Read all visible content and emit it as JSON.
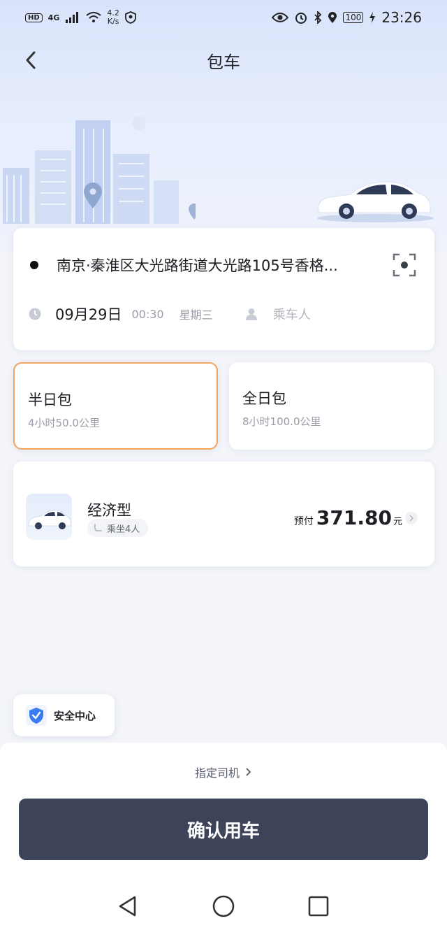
{
  "status_bar": {
    "hd_badge": "HD",
    "network": "4G",
    "speed_value": "4.2",
    "speed_unit": "K/s",
    "battery": "100",
    "time": "23:26"
  },
  "header": {
    "title": "包车"
  },
  "trip": {
    "address": "南京·秦淮区大光路街道大光路105号香格...",
    "date": "09月29日",
    "hour": "00:30",
    "weekday": "星期三",
    "passenger_placeholder": "乘车人"
  },
  "packages": [
    {
      "title": "半日包",
      "desc": "4小时50.0公里",
      "selected": true
    },
    {
      "title": "全日包",
      "desc": "8小时100.0公里",
      "selected": false
    }
  ],
  "vehicle": {
    "type": "经济型",
    "seats": "乘坐4人",
    "prepay_label": "预付",
    "price": "371.80",
    "unit": "元"
  },
  "safety": {
    "label": "安全中心"
  },
  "footer": {
    "assign_driver": "指定司机",
    "confirm_label": "确认用车"
  },
  "colors": {
    "accent_selected": "#f2a35e",
    "confirm_bg": "#3d4459",
    "shield": "#3b7bf0"
  }
}
